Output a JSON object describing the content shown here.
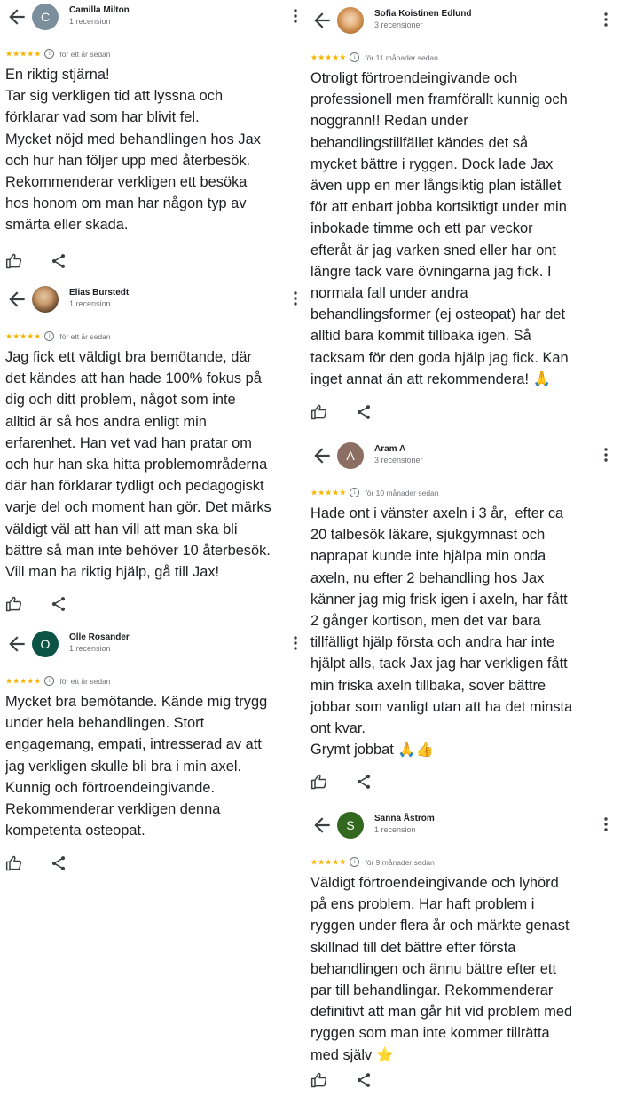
{
  "reviews": [
    {
      "reviewer": "Camilla Milton",
      "count": "1 recension",
      "avatar_letter": "C",
      "avatar_color": "#7b8e9b",
      "stars": "★★★★★",
      "time": "för ett år sedan",
      "text": "En riktig stjärna!\nTar sig verkligen tid att lyssna och\nförklarar vad som har blivit fel.\nMycket nöjd med behandlingen hos Jax\noch hur han följer upp med återbesök.\nRekommenderar verkligen ett besöka\nhos honom om man har någon typ av\nsmärta eller skada."
    },
    {
      "reviewer": "Elias Burstedt",
      "count": "1 recension",
      "avatar_letter": "",
      "avatar_color": "#8a6a4a",
      "stars": "★★★★★",
      "time": "för ett år sedan",
      "text": "Jag fick ett väldigt bra bemötande, där\ndet kändes att han hade 100% fokus på\ndig och ditt problem, något som inte\nalltid är så hos andra enligt min\nerfarenhet. Han vet vad han pratar om\noch hur han ska hitta problemområderna\ndär han förklarar tydligt och pedagogiskt\nvarje del och moment han gör. Det märks\nväldigt väl att han vill att man ska bli\nbättre så man inte behöver 10 återbesök.\nVill man ha riktig hjälp, gå till Jax!"
    },
    {
      "reviewer": "Olle Rosander",
      "count": "1 recension",
      "avatar_letter": "O",
      "avatar_color": "#0b5345",
      "stars": "★★★★★",
      "time": "för ett år sedan",
      "text": "Mycket bra bemötande. Kände mig trygg\nunder hela behandlingen. Stort\nengagemang, empati, intresserad av att\njag verkligen skulle bli bra i min axel.\nKunnig och förtroendeingivande.\nRekommenderar verkligen denna\nkompetenta osteopat."
    },
    {
      "reviewer": "Sofia Koistinen Edlund",
      "count": "3 recensioner",
      "avatar_letter": "",
      "avatar_color": "#d9a36a",
      "stars": "★★★★★",
      "time": "för 11 månader sedan",
      "text": "Otroligt förtroendeingivande och\nprofessionell men framförallt kunnig och\nnoggrann!! Redan under\nbehandlingstillfället kändes det så\nmycket bättre i ryggen. Dock lade Jax\näven upp en mer långsiktig plan istället\nför att enbart jobba kortsiktigt under min\ninbokade timme och ett par veckor\nefteråt är jag varken sned eller har ont\nlängre tack vare övningarna jag fick. I\nnormala fall under andra\nbehandlingsformer (ej osteopat) har det\nalltid bara kommit tillbaka igen. Så\ntacksam för den goda hjälp jag fick. Kan\ninget annat än att rekommendera! 🙏"
    },
    {
      "reviewer": "Aram A",
      "count": "3 recensioner",
      "avatar_letter": "A",
      "avatar_color": "#8d6e63",
      "stars": "★★★★★",
      "time": "för 10 månader sedan",
      "text": "Hade ont i vänster axeln i 3 år,  efter ca\n20 talbesök läkare, sjukgymnast och\nnaprapat kunde inte hjälpa min onda\naxeln, nu efter 2 behandling hos Jax\nkänner jag mig frisk igen i axeln, har fått\n2 gånger kortison, men det var bara\ntillfälligt hjälp första och andra har inte\nhjälpt alls, tack Jax jag har verkligen fått\nmin friska axeln tillbaka, sover bättre\njobbar som vanligt utan att ha det minsta\nont kvar.\nGrymt jobbat 🙏👍"
    },
    {
      "reviewer": "Sanna Åström",
      "count": "1 recension",
      "avatar_letter": "S",
      "avatar_color": "#33691e",
      "stars": "★★★★★",
      "time": "för 9 månader sedan",
      "text": "Väldigt förtroendeingivande och lyhörd\npå ens problem. Har haft problem i\nryggen under flera år och märkte genast\nskillnad till det bättre efter första\nbehandlingen och ännu bättre efter ett\npar till behandlingar. Rekommenderar\ndefinitivt att man går hit vid problem med\nryggen som man inte kommer tillrätta\nmed själv ⭐"
    }
  ],
  "icons": {
    "back": "arrow-left-icon",
    "more": "more-vert-icon",
    "like": "thumb-up-icon",
    "share": "share-icon",
    "info": "info-icon"
  }
}
